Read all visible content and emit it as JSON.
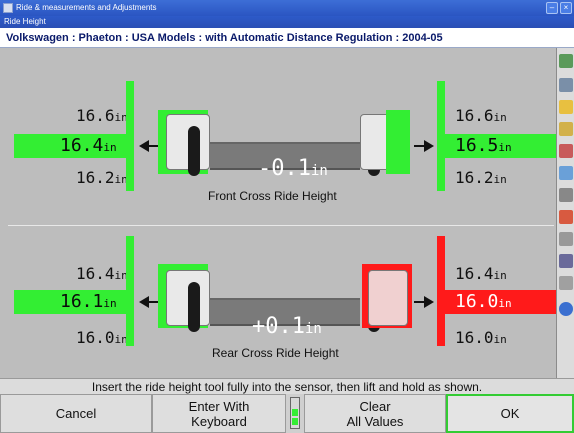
{
  "window": {
    "title": "Ride & measurements and Adjustments",
    "subtitle": "Ride Height"
  },
  "vehicle": "Volkswagen : Phaeton : USA Models : with Automatic Distance Regulation : 2004-05",
  "unit": "in",
  "front": {
    "label": "Front Cross Ride Height",
    "cross_value": "-0.1",
    "left": {
      "max": "16.6",
      "value": "16.4",
      "min": "16.2",
      "status": "in-spec"
    },
    "right": {
      "max": "16.6",
      "value": "16.5",
      "min": "16.2",
      "status": "in-spec"
    }
  },
  "rear": {
    "label": "Rear Cross Ride Height",
    "cross_value": "+0.1",
    "left": {
      "max": "16.4",
      "value": "16.1",
      "min": "16.0",
      "status": "in-spec"
    },
    "right": {
      "max": "16.4",
      "value": "16.0",
      "min": "16.0",
      "status": "out-of-spec"
    }
  },
  "instruction": "Insert the ride height tool fully into the sensor, then lift and hold as shown.",
  "buttons": {
    "cancel": "Cancel",
    "enter_keyboard_line1": "Enter With",
    "enter_keyboard_line2": "Keyboard",
    "clear_line1": "Clear",
    "clear_line2": "All Values",
    "ok": "OK"
  },
  "colors": {
    "in_spec": "#33ee33",
    "out_of_spec": "#ff1a1a",
    "title_bar": "#2a55c2"
  },
  "toolbar_icons": [
    "wheel-icon",
    "vehicle-icon",
    "alert-icon",
    "tools-icon",
    "ladder-icon",
    "chart-icon",
    "gear-icon",
    "flag-icon",
    "camera-icon",
    "list-icon",
    "print-icon",
    "help-icon"
  ]
}
